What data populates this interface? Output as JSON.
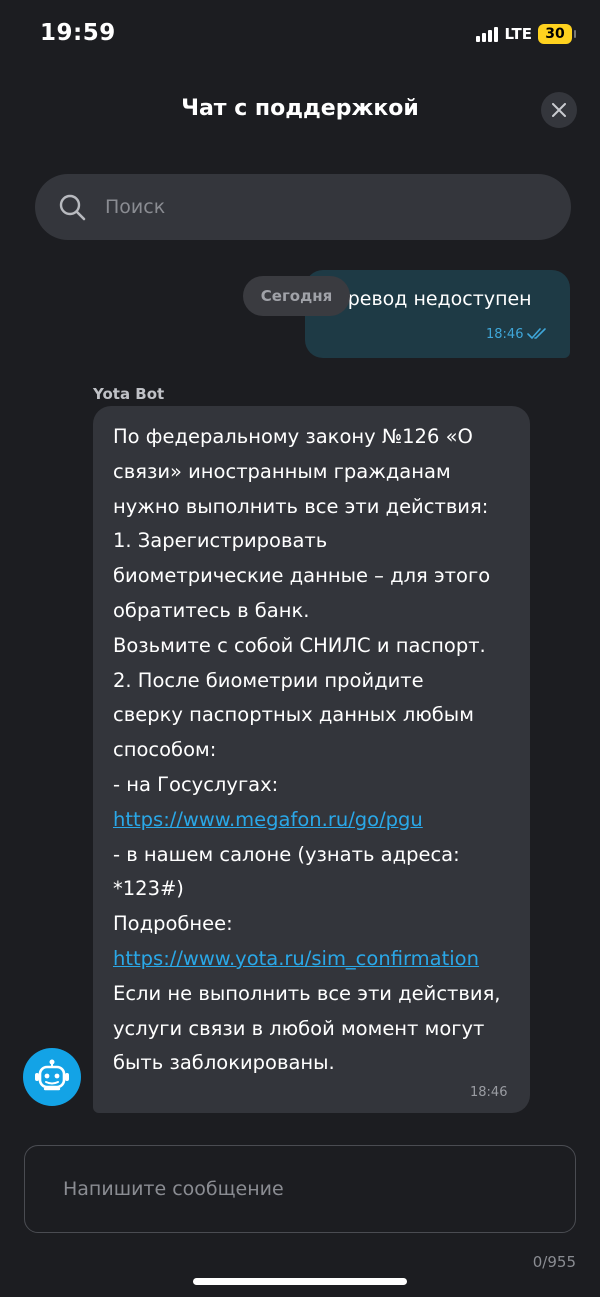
{
  "status_bar": {
    "time": "19:59",
    "network": "LTE",
    "battery": "30"
  },
  "header": {
    "title": "Чат с поддержкой",
    "close_icon": "close-icon"
  },
  "search": {
    "placeholder": "Поиск",
    "icon": "search-icon"
  },
  "date_chip": "Сегодня",
  "outgoing": {
    "text": "еревод недоступен",
    "time": "18:46",
    "status_icon": "double-check-icon"
  },
  "bot": {
    "name": "Yota Bot",
    "avatar_icon": "robot-icon",
    "time": "18:46",
    "lines": [
      "По федеральному закону №126 «О",
      "связи» иностранным гражданам",
      "нужно выполнить все эти действия:",
      "1. Зарегистрировать",
      "биометрические данные – для этого",
      "обратитесь в банк.",
      "Возьмите с собой СНИЛС и паспорт.",
      "2. После биометрии пройдите",
      "сверку паспортных данных любым",
      "способом:",
      "- на Госуслугах:",
      "https://www.megafon.ru/go/pgu",
      "- в нашем салоне (узнать адреса:",
      "*123#)",
      "Подробнее:",
      "https://www.yota.ru/sim_confirmation",
      "Если не выполнить все эти действия,",
      "услуги связи в любой момент могут",
      "быть заблокированы."
    ]
  },
  "composer": {
    "placeholder": "Напишите сообщение",
    "counter": "0/955"
  },
  "colors": {
    "background": "#1c1d21",
    "accent": "#13a3e6",
    "link": "#2aa8e8",
    "battery": "#ffd21f"
  }
}
